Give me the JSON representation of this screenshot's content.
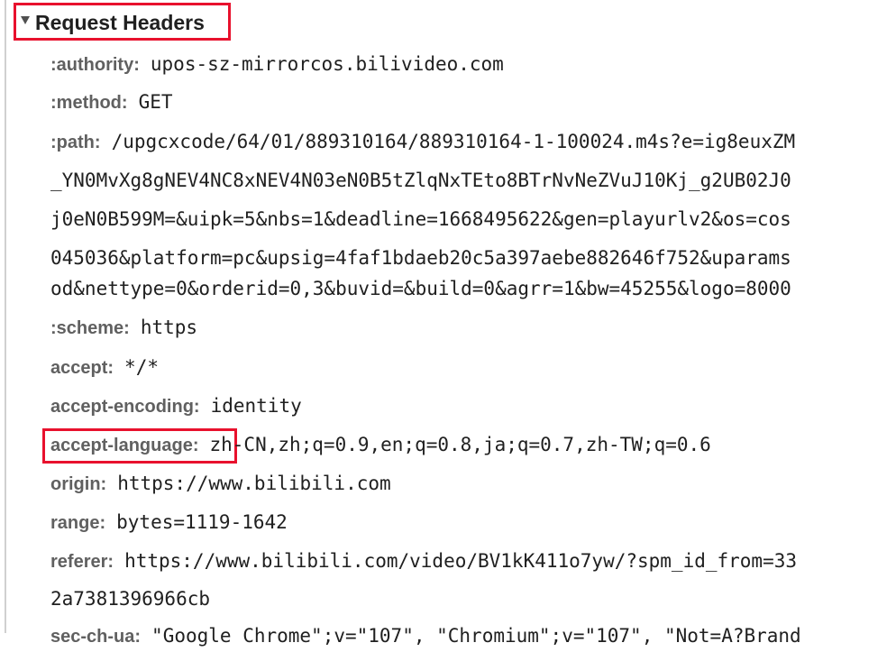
{
  "section": {
    "title": "Request Headers",
    "toggle_icon": "disclosure-triangle-down-icon"
  },
  "headers": [
    {
      "name": ":authority",
      "value": "upos-sz-mirrorcos.bilivideo.com"
    },
    {
      "name": ":method",
      "value": "GET"
    },
    {
      "name": ":path",
      "value": "/upgcxcode/64/01/889310164/889310164-1-100024.m4s?e=ig8euxZM",
      "continuation": [
        "_YN0MvXg8gNEV4NC8xNEV4N03eN0B5tZlqNxTEto8BTrNvNeZVuJ10Kj_g2UB02J0",
        "j0eN0B599M=&uipk=5&nbs=1&deadline=1668495622&gen=playurlv2&os=cos",
        "045036&platform=pc&upsig=4faf1bdaeb20c5a397aebe882646f752&uparams",
        "od&nettype=0&orderid=0,3&buvid=&build=0&agrr=1&bw=45255&logo=8000"
      ]
    },
    {
      "name": ":scheme",
      "value": "https"
    },
    {
      "name": "accept",
      "value": "*/*"
    },
    {
      "name": "accept-encoding",
      "value": "identity"
    },
    {
      "name": "accept-language",
      "value": "zh-CN,zh;q=0.9,en;q=0.8,ja;q=0.7,zh-TW;q=0.6"
    },
    {
      "name": "origin",
      "value": "https://www.bilibili.com"
    },
    {
      "name": "range",
      "value": "bytes=1119-1642"
    },
    {
      "name": "referer",
      "value": "https://www.bilibili.com/video/BV1kK411o7yw/?spm_id_from=33",
      "continuation": [
        "2a7381396966cb"
      ]
    },
    {
      "name": "sec-ch-ua",
      "value": "\"Google Chrome\";v=\"107\", \"Chromium\";v=\"107\", \"Not=A?Brand"
    }
  ],
  "colors": {
    "highlight": "#e8112d",
    "header_name": "#606060",
    "value_text": "#202020"
  }
}
